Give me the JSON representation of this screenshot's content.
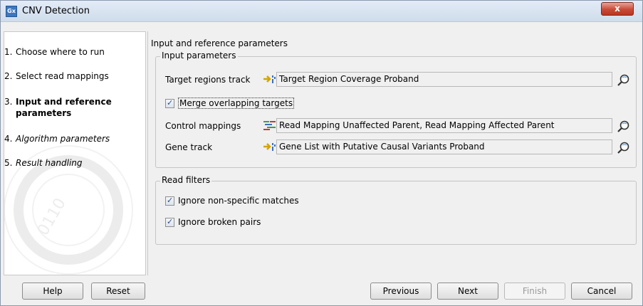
{
  "window": {
    "title": "CNV Detection",
    "app_icon_text": "Gx",
    "close_label": "x"
  },
  "steps": [
    {
      "num": "1.",
      "label": "Choose where to run"
    },
    {
      "num": "2.",
      "label": "Select read mappings"
    },
    {
      "num": "3.",
      "label": "Input and reference parameters"
    },
    {
      "num": "4.",
      "label": "Algorithm parameters"
    },
    {
      "num": "5.",
      "label": "Result handling"
    }
  ],
  "panel": {
    "heading": "Input and reference parameters",
    "input_group": {
      "title": "Input parameters",
      "target_label": "Target regions track",
      "target_value": "Target Region Coverage Proband",
      "merge_label": "Merge overlapping targets",
      "merge_checked": true,
      "control_label": "Control mappings",
      "control_value": "Read Mapping Unaffected Parent, Read Mapping Affected Parent",
      "gene_label": "Gene track",
      "gene_value": "Gene List with Putative Causal Variants Proband"
    },
    "read_filters": {
      "title": "Read filters",
      "ignore_nonspecific_label": "Ignore non-specific matches",
      "ignore_nonspecific_checked": true,
      "ignore_broken_label": "Ignore broken pairs",
      "ignore_broken_checked": true
    }
  },
  "buttons": {
    "help": "Help",
    "reset": "Reset",
    "previous": "Previous",
    "next": "Next",
    "finish": "Finish",
    "cancel": "Cancel"
  }
}
